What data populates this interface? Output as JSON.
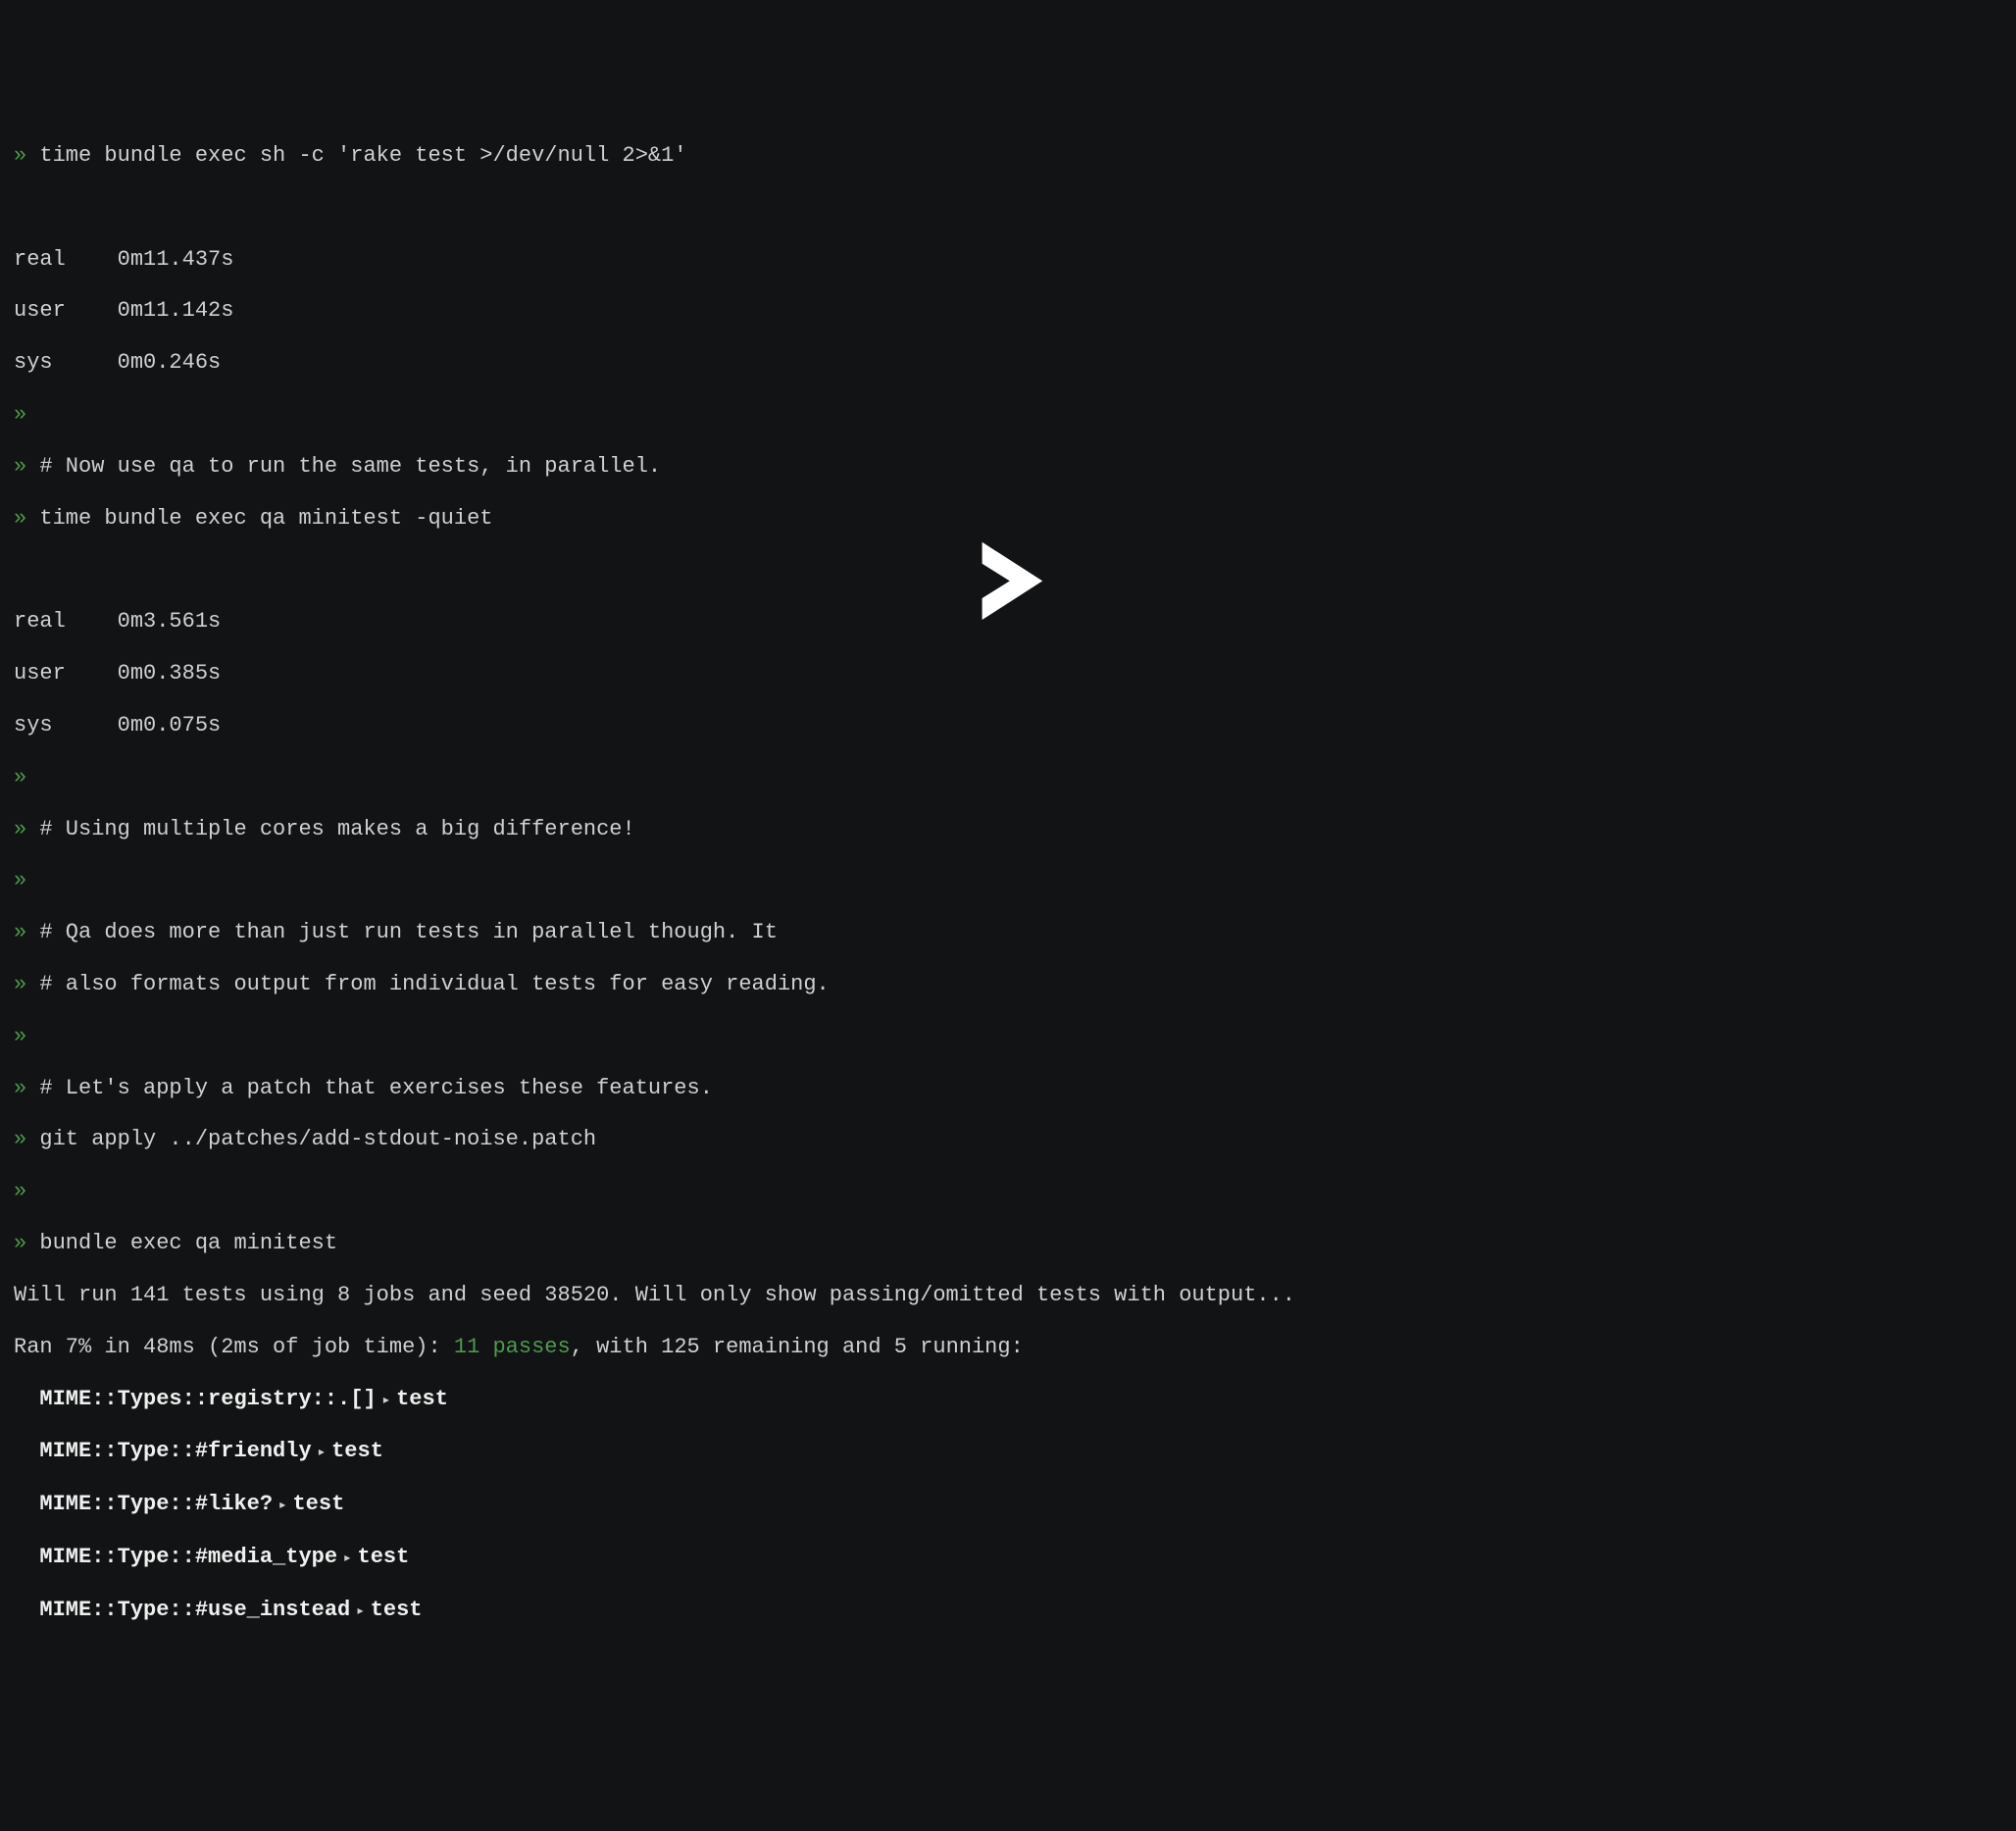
{
  "prompt": "»",
  "lines": {
    "cmd1": "time bundle exec sh -c 'rake test >/dev/null 2>&1'",
    "time1_real": "real    0m11.437s",
    "time1_user": "user    0m11.142s",
    "time1_sys": "sys     0m0.246s",
    "comment1": "# Now use qa to run the same tests, in parallel.",
    "cmd2": "time bundle exec qa minitest -quiet",
    "time2_real": "real    0m3.561s",
    "time2_user": "user    0m0.385s",
    "time2_sys": "sys     0m0.075s",
    "comment2": "# Using multiple cores makes a big difference!",
    "comment3": "# Qa does more than just run tests in parallel though. It",
    "comment4": "# also formats output from individual tests for easy reading.",
    "comment5": "# Let's apply a patch that exercises these features.",
    "cmd3": "git apply ../patches/add-stdout-noise.patch",
    "cmd4": "bundle exec qa minitest",
    "out1": "Will run 141 tests using 8 jobs and seed 38520. Will only show passing/omitted tests with output...",
    "out2_a": "Ran 7% in 48ms (2ms of job time): ",
    "out2_b": "11 passes",
    "out2_c": ", with 125 remaining and 5 running:",
    "t1_a": "MIME::Types::registry::.[]",
    "t1_b": "test",
    "t2_a": "MIME::Type::#friendly",
    "t2_b": "test",
    "t3_a": "MIME::Type::#like?",
    "t3_b": "test",
    "t4_a": "MIME::Type::#media_type",
    "t4_b": "test",
    "t5_a": "MIME::Type::#use_instead",
    "t5_b": "test"
  },
  "sep": " ▸ "
}
